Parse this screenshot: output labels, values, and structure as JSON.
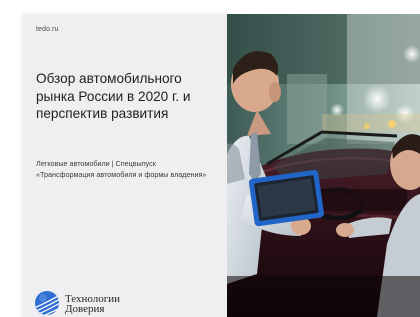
{
  "cover": {
    "site_url": "tedo.ru",
    "title": "Обзор автомобильного рынка России в 2020 г. и перспектив развития",
    "subtitle": "Легковые автомобили | Спецвыпуск «Трансформация автомобиля и формы владения»",
    "logo": {
      "line1": "Технологии",
      "line2": "Доверия",
      "icon": "sphere-logo-icon",
      "color": "#2f6ed3"
    }
  },
  "photo": {
    "subject": "car-showroom-photo"
  },
  "colors": {
    "panel_background": "#efeff1",
    "title_text": "#1f1f1f",
    "logo_blue": "#2f6ed3"
  }
}
